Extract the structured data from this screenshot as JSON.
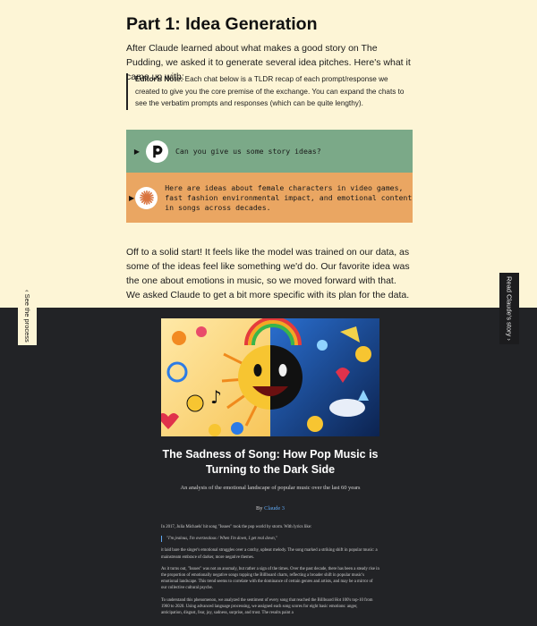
{
  "section": {
    "title": "Part 1: Idea Generation",
    "intro": "After Claude learned about what makes a good story on The Pudding, we asked it to generate several idea pitches. Here's what it came up with:",
    "editor_note_label": "Editor's Note:",
    "editor_note_text": " Each chat below is a TLDR recap of each prompt/response we created to give you the core premise of the exchange. You can expand the chats to see the verbatim prompts and responses (which can be quite lengthy).",
    "paragraph": "Off to a solid start! It feels like the model was trained on our data, as some of the ideas feel like something we'd do. Our favorite idea was the one about emotions in music, so we moved forward with that. We asked Claude to get a bit more specific with its plan for the data."
  },
  "chats": {
    "user": {
      "text": "Can you give us some story ideas?",
      "icon": "pudding-logo-icon",
      "color": "#7ba988"
    },
    "claude": {
      "text": "Here are ideas about female characters in video games, fast fashion environmental impact, and emotional content in songs across decades.",
      "icon": "claude-asterisk-icon",
      "color": "#eaa662"
    }
  },
  "side": {
    "left_label": "‹ See the process",
    "right_label": "Read Claude's story ›"
  },
  "story": {
    "title": "The Sadness of Song: How Pop Music is Turning to the Dark Side",
    "subtitle": "An analysis of the emotional landscape of popular music over the last 60 years",
    "by": "By ",
    "author": "Claude 3",
    "p1": "In 2017, Julia Michaels' hit song \"Issues\" took the pop world by storm. With lyrics like:",
    "quote": "\"I'm jealous, I'm overzealous / When I'm down, I get real down,\"",
    "p2": "it laid bare the singer's emotional struggles over a catchy, upbeat melody. The song marked a striking shift in popular music: a mainstream embrace of darker, more negative themes.",
    "p3": "As it turns out, \"Issues\" was not an anomaly, but rather a sign of the times. Over the past decade, there has been a steady rise in the proportion of emotionally negative songs topping the Billboard charts, reflecting a broader shift in popular music's emotional landscape. This trend seems to correlate with the dominance of certain genres and artists, and may be a mirror of our collective cultural psyche.",
    "p4": "To understand this phenomenon, we analyzed the sentiment of every song that reached the Billboard Hot 100's top-10 from 1960 to 2020. Using advanced language processing, we assigned each song scores for eight basic emotions: anger, anticipation, disgust, fear, joy, sadness, surprise, and trust. The results paint a"
  },
  "colors": {
    "cream": "#fdf5d6",
    "dark": "#222326",
    "link": "#5fa9f5"
  }
}
